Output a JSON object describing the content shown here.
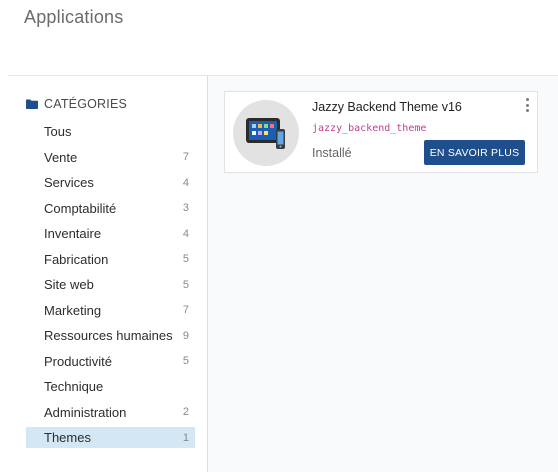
{
  "page": {
    "title": "Applications"
  },
  "sidebar": {
    "header": "CATÉGORIES",
    "header_icon": "folder-icon",
    "categories": [
      {
        "label": "Tous",
        "count": ""
      },
      {
        "label": "Vente",
        "count": "7"
      },
      {
        "label": "Services",
        "count": "4"
      },
      {
        "label": "Comptabilité",
        "count": "3"
      },
      {
        "label": "Inventaire",
        "count": "4"
      },
      {
        "label": "Fabrication",
        "count": "5"
      },
      {
        "label": "Site web",
        "count": "5"
      },
      {
        "label": "Marketing",
        "count": "7"
      },
      {
        "label": "Ressources humaines",
        "count": "9"
      },
      {
        "label": "Productivité",
        "count": "5"
      },
      {
        "label": "Technique",
        "count": ""
      },
      {
        "label": "Administration",
        "count": "2"
      },
      {
        "label": "Themes",
        "count": "1"
      }
    ],
    "active_category": "Themes"
  },
  "app_card": {
    "name": "Jazzy Backend Theme v16",
    "technical_name": "jazzy_backend_theme",
    "status": "Installé",
    "button_label": "EN SAVOIR PLUS",
    "icon": "devices-icon",
    "menu_icon": "kebab-menu-icon"
  },
  "colors": {
    "accent": "#1e4f8c",
    "active_bg": "#d4e7f4",
    "technical_name": "#c0428a"
  }
}
